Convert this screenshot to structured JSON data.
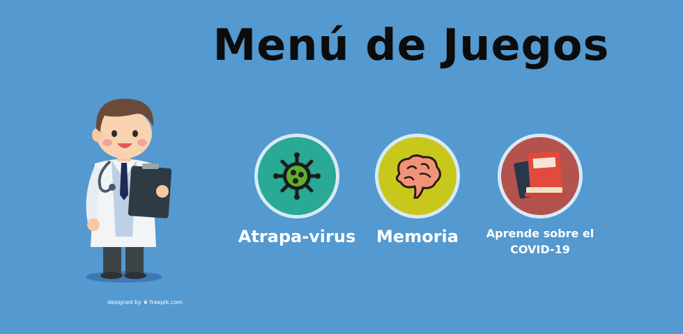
{
  "title": "Menú de Juegos",
  "games": [
    {
      "label": "Atrapa-virus",
      "icon": "virus-icon",
      "color": "#2aa995"
    },
    {
      "label": "Memoria",
      "icon": "brain-icon",
      "color": "#c8c81c"
    },
    {
      "label_line1": "Aprende sobre el",
      "label_line2": "COVID-19",
      "icon": "books-icon",
      "color": "#b4524d"
    }
  ],
  "credit": "designed by ❦ freepik.com",
  "colors": {
    "background": "#5499cf",
    "ring": "#d6eaf7"
  }
}
